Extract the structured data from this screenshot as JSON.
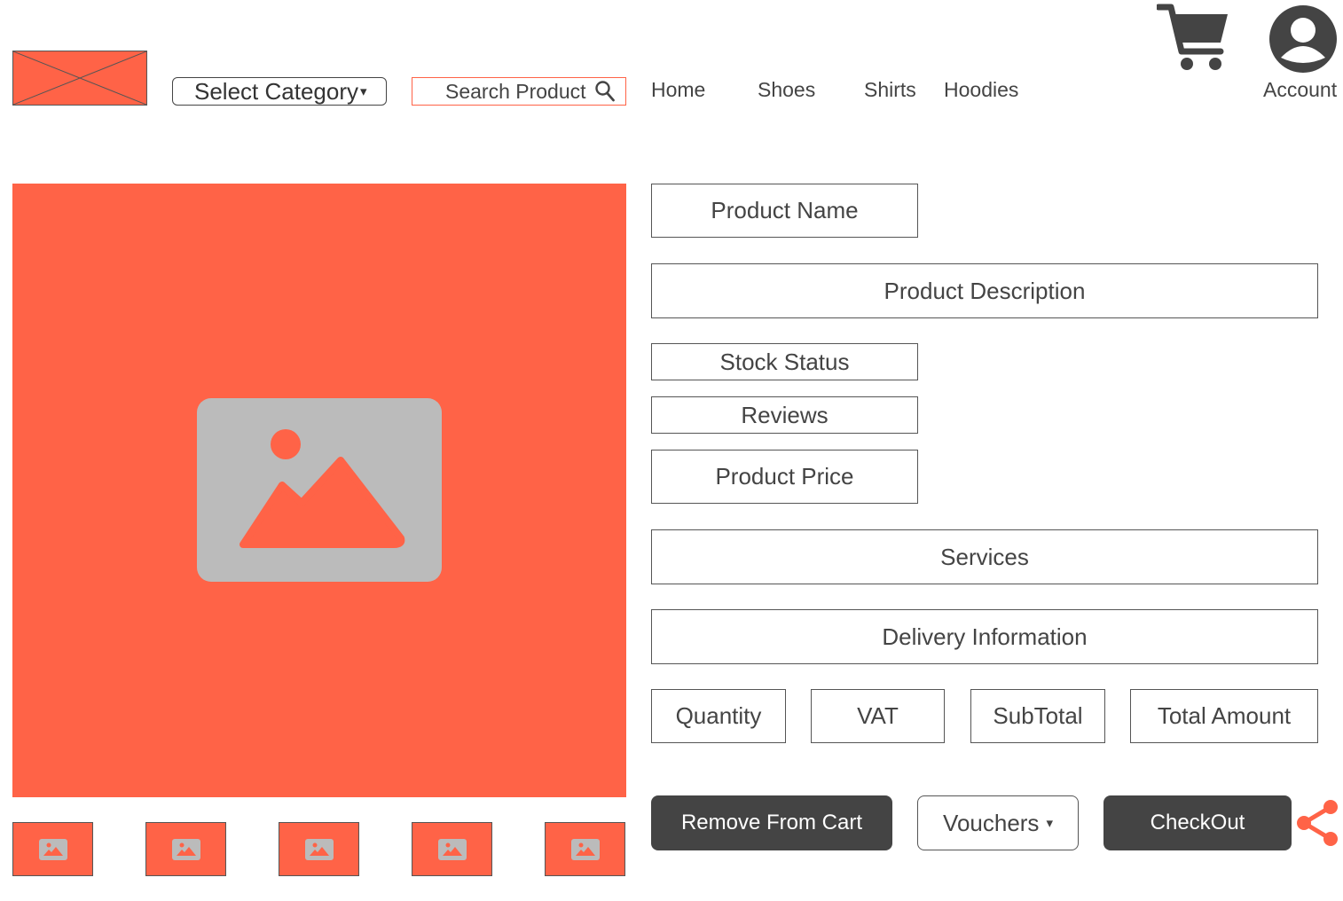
{
  "colors": {
    "accent": "#ff6347",
    "dark": "#444444",
    "placeholder_gray": "#bbbbbb"
  },
  "header": {
    "logo_icon": "image-placeholder-icon",
    "category_select": {
      "value": "Select Category",
      "caret": "▾"
    },
    "search": {
      "placeholder": "Search Product",
      "icon": "search-icon"
    },
    "nav": [
      "Home",
      "Shoes",
      "Shirts",
      "Hoodies"
    ],
    "cart_icon": "shopping-cart-icon",
    "account": {
      "label": "Account",
      "icon": "user-account-icon"
    }
  },
  "gallery": {
    "main_icon": "image-placeholder-icon",
    "thumbnail_count": 5
  },
  "product": {
    "name": "Product Name",
    "description": "Product Description",
    "stock_status": "Stock Status",
    "reviews": "Reviews",
    "price": "Product Price",
    "services": "Services",
    "delivery": "Delivery Information"
  },
  "totals": {
    "quantity": "Quantity",
    "vat": "VAT",
    "subtotal": "SubTotal",
    "total": "Total Amount"
  },
  "actions": {
    "remove": "Remove From Cart",
    "vouchers": "Vouchers",
    "vouchers_caret": "▾",
    "checkout": "CheckOut",
    "share_icon": "share-icon"
  }
}
